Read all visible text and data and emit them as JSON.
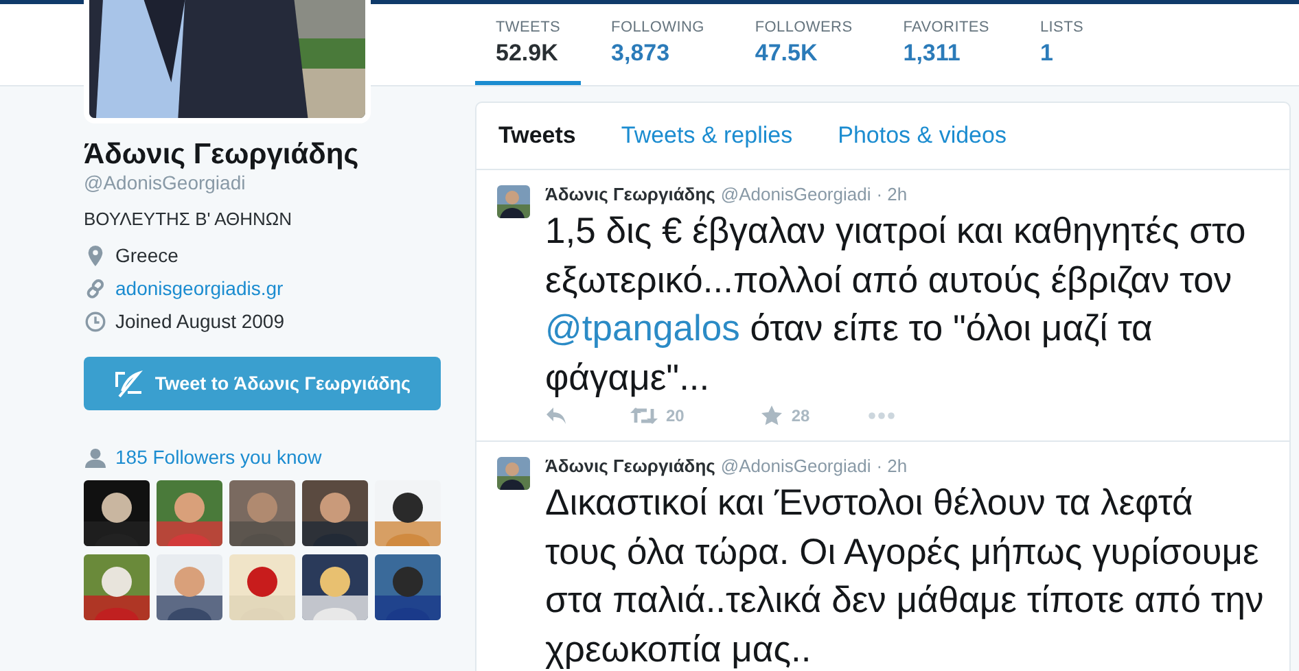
{
  "stats": [
    {
      "label": "TWEETS",
      "value": "52.9K",
      "selected": true
    },
    {
      "label": "FOLLOWING",
      "value": "3,873",
      "selected": false
    },
    {
      "label": "FOLLOWERS",
      "value": "47.5K",
      "selected": false
    },
    {
      "label": "FAVORITES",
      "value": "1,311",
      "selected": false
    },
    {
      "label": "LISTS",
      "value": "1",
      "selected": false
    }
  ],
  "profile": {
    "name": "Άδωνις Γεωργιάδης",
    "handle": "@AdonisGeorgiadi",
    "bio": "ΒΟΥΛΕΥΤΗΣ Β' ΑΘΗΝΩΝ",
    "location": "Greece",
    "website": "adonisgeorgiadis.gr",
    "joined": "Joined August 2009",
    "tweet_button": "Tweet to Άδωνις Γεωργιάδης"
  },
  "followers_you_know": {
    "label": "185 Followers you know"
  },
  "tabs": [
    {
      "label": "Tweets",
      "selected": true
    },
    {
      "label": "Tweets & replies",
      "selected": false
    },
    {
      "label": "Photos & videos",
      "selected": false
    }
  ],
  "tweets": [
    {
      "author": "Άδωνις Γεωργιάδης",
      "handle": "@AdonisGeorgiadi",
      "time": "· 2h",
      "segments": [
        {
          "kind": "text",
          "text": "1,5 δις € έβγαλαν γιατροί και καθηγητές στο εξωτερικό...πολλοί από αυτούς έβριζαν τον "
        },
        {
          "kind": "mention",
          "text": "@tpangalos"
        },
        {
          "kind": "text",
          "text": " όταν είπε το \"όλοι μαζί τα φάγαμε\"..."
        }
      ],
      "retweets": "20",
      "favorites": "28"
    },
    {
      "author": "Άδωνις Γεωργιάδης",
      "handle": "@AdonisGeorgiadi",
      "time": "· 2h",
      "segments": [
        {
          "kind": "text",
          "text": "Δικαστικοί και Ένστολοι θέλουν τα λεφτά τους όλα τώρα. Οι Αγορές μήπως γυρίσουμε στα παλιά..τελικά δεν μάθαμε τίποτε από την χρεωκοπία μας.."
        }
      ]
    }
  ]
}
